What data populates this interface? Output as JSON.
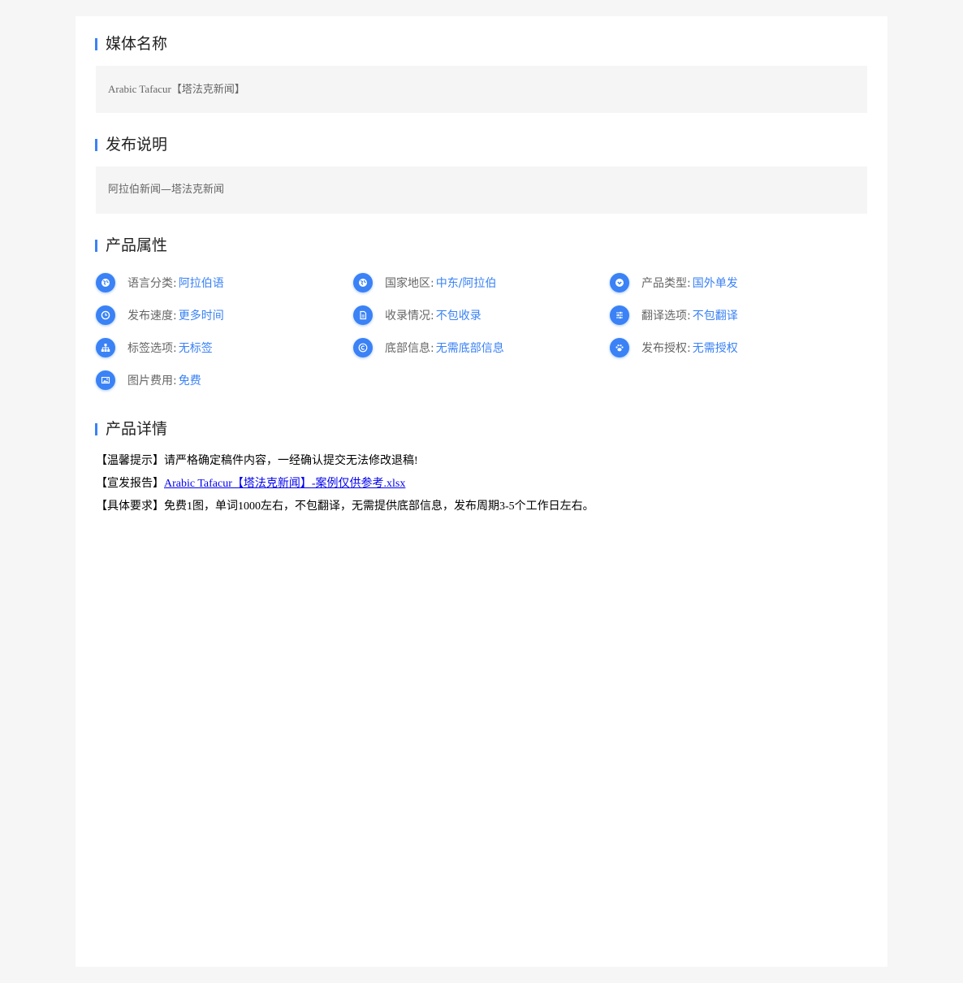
{
  "media_name": {
    "title": "媒体名称",
    "value": "Arabic Tafacur【塔法克新闻】"
  },
  "description": {
    "title": "发布说明",
    "value": "阿拉伯新闻—塔法克新闻"
  },
  "attributes": {
    "title": "产品属性",
    "items": [
      {
        "label": "语言分类:",
        "value": "阿拉伯语",
        "icon": "globe-icon"
      },
      {
        "label": "国家地区:",
        "value": "中东/阿拉伯",
        "icon": "globe-icon"
      },
      {
        "label": "产品类型:",
        "value": "国外单发",
        "icon": "chevron-down-circle-icon"
      },
      {
        "label": "发布速度:",
        "value": "更多时间",
        "icon": "clock-icon"
      },
      {
        "label": "收录情况:",
        "value": "不包收录",
        "icon": "document-icon"
      },
      {
        "label": "翻译选项:",
        "value": "不包翻译",
        "icon": "sliders-icon"
      },
      {
        "label": "标签选项:",
        "value": "无标签",
        "icon": "sitemap-icon"
      },
      {
        "label": "底部信息:",
        "value": "无需底部信息",
        "icon": "copyright-icon"
      },
      {
        "label": "发布授权:",
        "value": "无需授权",
        "icon": "paw-icon"
      },
      {
        "label": "图片费用:",
        "value": "免费",
        "icon": "image-icon"
      }
    ]
  },
  "details": {
    "title": "产品详情",
    "tip_prefix": "【温馨提示】",
    "tip_text": "请严格确定稿件内容，一经确认提交无法修改退稿!",
    "report_prefix": "【宣发报告】",
    "report_link": "Arabic Tafacur【塔法克新闻】-案例仅供参考.xlsx",
    "req_prefix": "【具体要求】",
    "req_text": "免费1图，单词1000左右，不包翻译，无需提供底部信息，发布周期3-5个工作日左右。"
  },
  "colors": {
    "accent": "#3a82f5",
    "page_bg": "#f6f6f6",
    "box_bg": "#f5f5f5",
    "link": "#0000ee"
  }
}
